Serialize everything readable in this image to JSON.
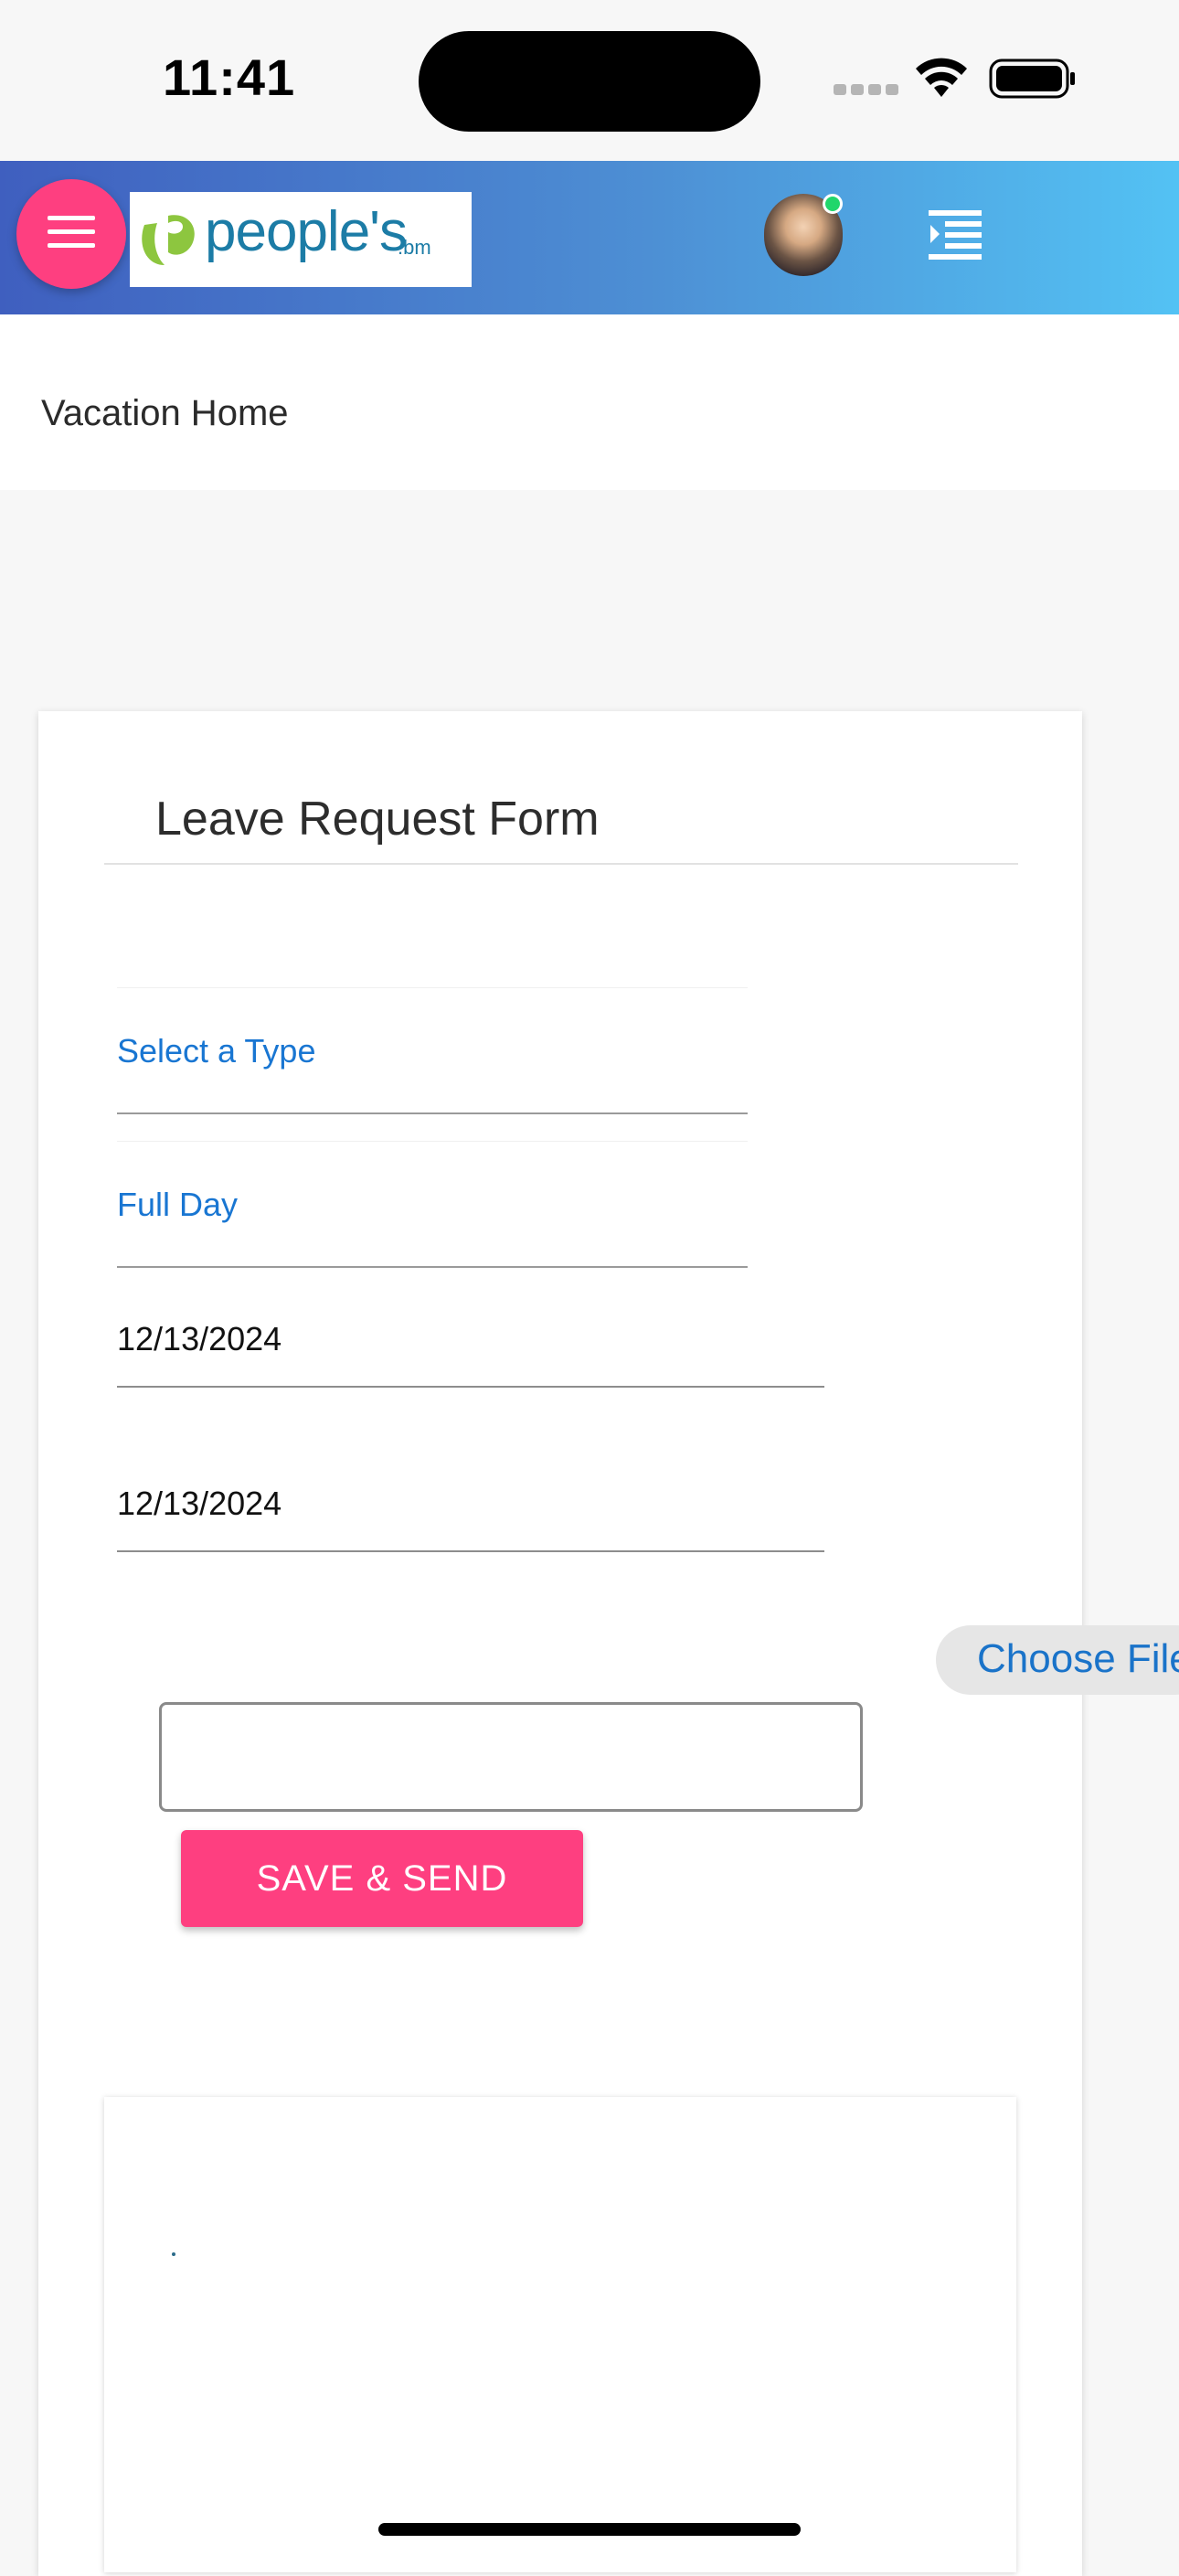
{
  "status_bar": {
    "time": "11:41"
  },
  "app_bar": {
    "logo_word": "people's",
    "logo_suffix": ".bm"
  },
  "breadcrumb": {
    "label": "Vacation Home"
  },
  "form": {
    "title": "Leave Request Form",
    "type_select": {
      "value": "Select a Type"
    },
    "duration_select": {
      "value": "Full Day"
    },
    "start_date": "12/13/2024",
    "end_date": "12/13/2024",
    "choose_file_label": "Choose File",
    "comment_value": "",
    "submit_label": "SAVE & SEND"
  },
  "colors": {
    "accent": "#fe3f80",
    "header_gradient_start": "#3f5fbf",
    "header_gradient_end": "#53c2f4",
    "link_blue": "#1976d2"
  },
  "icons": [
    "hamburger-icon",
    "right-menu-icon",
    "wifi-icon",
    "battery-icon",
    "signal-icon"
  ]
}
